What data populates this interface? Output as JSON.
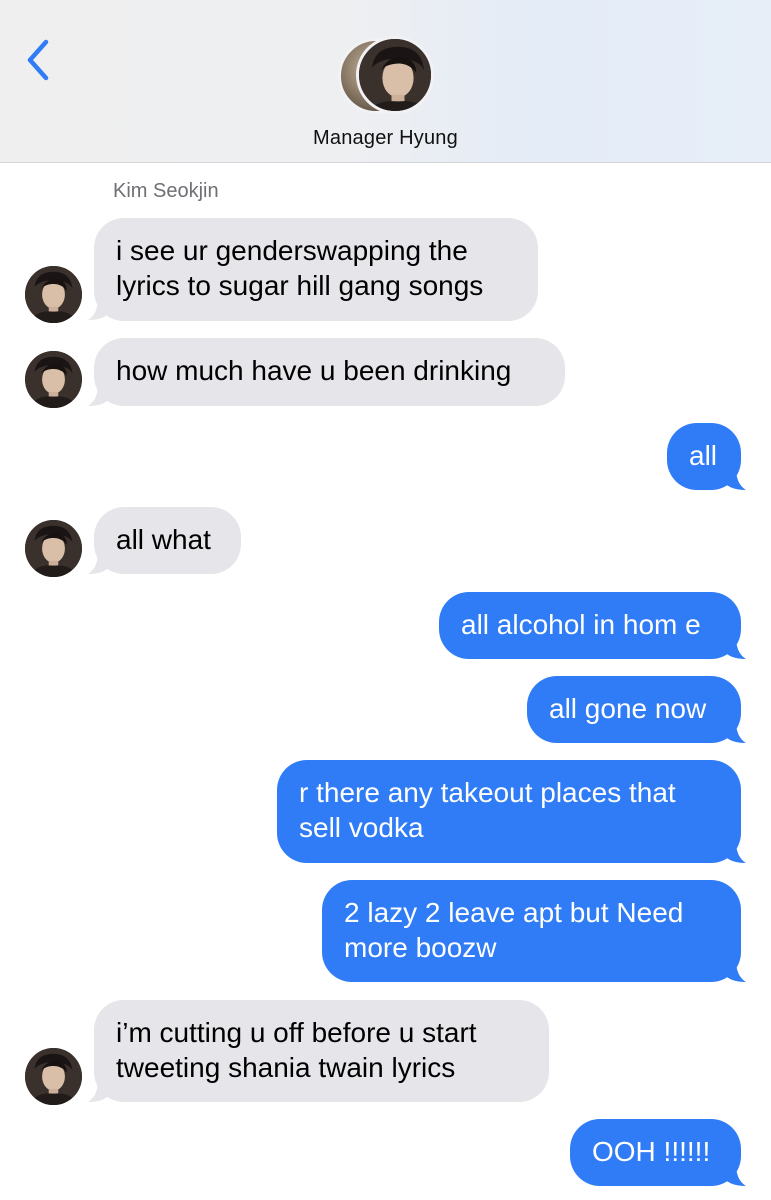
{
  "header": {
    "contact_name": "Manager Hyung",
    "back_icon": "chevron-left-icon",
    "accent_color": "#2f7cf6"
  },
  "thread": {
    "sender_name": "Kim Seokjin",
    "messages": [
      {
        "from": "them",
        "text": "i see ur genderswapping the\nlyrics to sugar hill gang songs"
      },
      {
        "from": "them",
        "text": "how much have u been drinking"
      },
      {
        "from": "me",
        "text": "all"
      },
      {
        "from": "them",
        "text": "all what"
      },
      {
        "from": "me",
        "text": "all alcohol in hom e"
      },
      {
        "from": "me",
        "text": "all gone now"
      },
      {
        "from": "me",
        "text": "r there any takeout places that\nsell vodka"
      },
      {
        "from": "me",
        "text": "2 lazy 2 leave apt but Need\nmore boozw"
      },
      {
        "from": "them",
        "text": "i’m cutting u off before u start\ntweeting shania twain lyrics"
      },
      {
        "from": "me",
        "text": "OOH !!!!!!"
      }
    ]
  },
  "colors": {
    "incoming_bubble": "#e5e5ea",
    "outgoing_bubble": "#2f7cf6"
  }
}
